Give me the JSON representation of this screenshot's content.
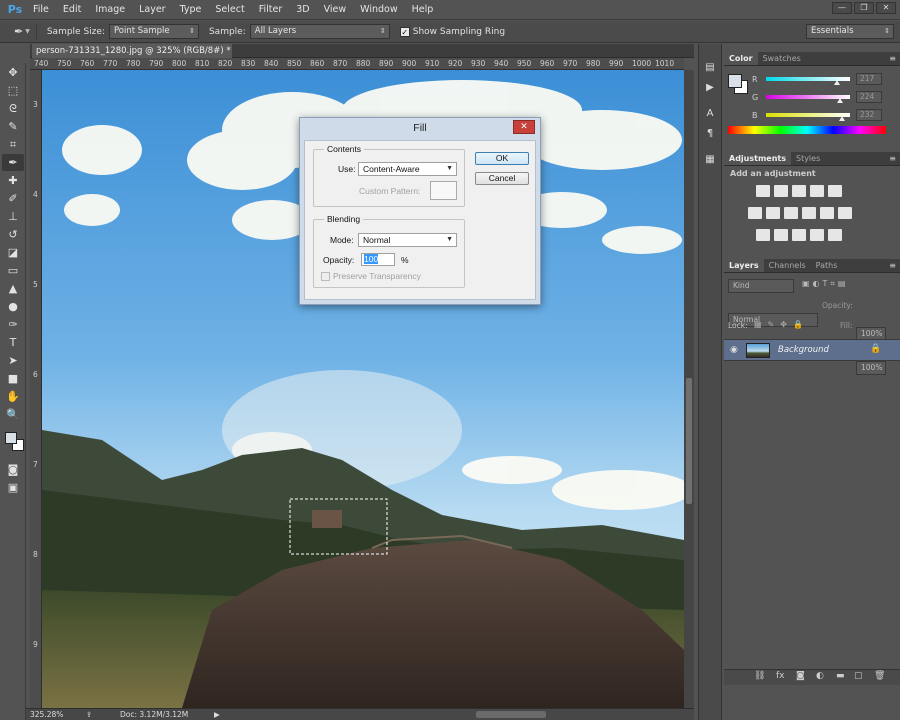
{
  "app": {
    "logo": "Ps",
    "menu": [
      "File",
      "Edit",
      "Image",
      "Layer",
      "Type",
      "Select",
      "Filter",
      "3D",
      "View",
      "Window",
      "Help"
    ],
    "window_controls": [
      "minimize-icon",
      "restore-icon",
      "close-icon"
    ]
  },
  "options_bar": {
    "tool_icon": "eyedropper-icon",
    "sample_size_label": "Sample Size:",
    "sample_size_value": "Point Sample",
    "sample_label": "Sample:",
    "sample_value": "All Layers",
    "show_ring_checked": true,
    "show_ring_label": "Show Sampling Ring",
    "workspace": "Essentials"
  },
  "document": {
    "tab_title": "person-731331_1280.jpg @ 325% (RGB/8#) *",
    "tab_close": "×",
    "ruler_top": [
      "740",
      "750",
      "760",
      "770",
      "780",
      "790",
      "800",
      "810",
      "820",
      "830",
      "840",
      "850",
      "860",
      "870",
      "880",
      "890",
      "900",
      "910",
      "920",
      "930",
      "940",
      "950",
      "960",
      "970",
      "980",
      "990",
      "1000",
      "1010"
    ],
    "ruler_left": [
      "3",
      "4",
      "5",
      "6",
      "7",
      "8",
      "9"
    ]
  },
  "status": {
    "zoom": "325.28%",
    "doc_info": "Doc: 3.12M/3.12M",
    "arrow": "▶"
  },
  "fill_dialog": {
    "title": "Fill",
    "contents_legend": "Contents",
    "use_label": "Use:",
    "use_value": "Content-Aware",
    "custom_pattern_label": "Custom Pattern:",
    "blending_legend": "Blending",
    "mode_label": "Mode:",
    "mode_value": "Normal",
    "opacity_label": "Opacity:",
    "opacity_value": "100",
    "opacity_unit": "%",
    "preserve_label": "Preserve Transparency",
    "ok_label": "OK",
    "cancel_label": "Cancel"
  },
  "color_panel": {
    "tabs": [
      "Color",
      "Swatches"
    ],
    "channels": [
      {
        "label": "R",
        "value": "217",
        "gradient_from": "#00d9e8",
        "gradient_to": "#ffffff",
        "level": 0.85
      },
      {
        "label": "G",
        "value": "224",
        "gradient_from": "#d900e8",
        "gradient_to": "#ffffff",
        "level": 0.88
      },
      {
        "label": "B",
        "value": "232",
        "gradient_from": "#d9e000",
        "gradient_to": "#ffffff",
        "level": 0.91
      }
    ],
    "foreground": "#d9e0e8",
    "background": "#ffffff"
  },
  "adjustments_panel": {
    "tabs": [
      "Adjustments",
      "Styles"
    ],
    "hint": "Add an adjustment"
  },
  "layers_panel": {
    "tabs": [
      "Layers",
      "Channels",
      "Paths"
    ],
    "kind_label": "Kind",
    "blend_mode": "Normal",
    "opacity_label": "Opacity:",
    "opacity_value": "100%",
    "lock_label": "Lock:",
    "fill_label": "Fill:",
    "fill_value": "100%",
    "layers": [
      {
        "name": "Background",
        "visible": true,
        "locked": true
      }
    ]
  }
}
